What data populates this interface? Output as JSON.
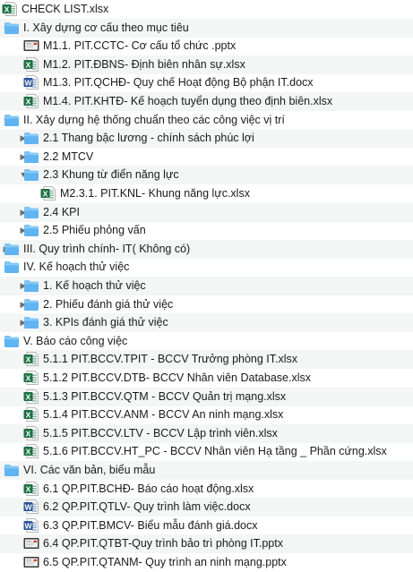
{
  "items": [
    {
      "label": "CHECK LIST.xlsx",
      "type": "xlsx",
      "level": 0,
      "toggle": "none"
    },
    {
      "label": "I. Xây dựng cơ cấu theo mục tiêu",
      "type": "folder",
      "level": 0,
      "toggle": "open"
    },
    {
      "label": "M1.1. PIT.CCTC- Cơ cấu tổ chức .pptx",
      "type": "pptx",
      "level": 1,
      "toggle": "none"
    },
    {
      "label": "M1.2. PIT.ĐBNS- Định biên nhân sự.xlsx",
      "type": "xlsx",
      "level": 1,
      "toggle": "none"
    },
    {
      "label": "M1.3. PIT.QCHĐ- Quy chế Hoạt động Bộ phận IT.docx",
      "type": "docx",
      "level": 1,
      "toggle": "none"
    },
    {
      "label": "M1.4. PIT.KHTĐ- Kế hoạch tuyển dụng theo định biên.xlsx",
      "type": "xlsx",
      "level": 1,
      "toggle": "none"
    },
    {
      "label": "II. Xây dựng hệ thống chuẩn theo các công việc vị trí",
      "type": "folder",
      "level": 0,
      "toggle": "open"
    },
    {
      "label": "2.1 Thang bậc lương - chính sách phúc lợi",
      "type": "folder",
      "level": 1,
      "toggle": "closed"
    },
    {
      "label": "2.2 MTCV",
      "type": "folder",
      "level": 1,
      "toggle": "closed"
    },
    {
      "label": "2.3 Khung từ điển năng lực",
      "type": "folder",
      "level": 1,
      "toggle": "open"
    },
    {
      "label": "M2.3.1. PIT.KNL- Khung năng lực.xlsx",
      "type": "xlsx",
      "level": 2,
      "toggle": "none"
    },
    {
      "label": "2.4 KPI",
      "type": "folder",
      "level": 1,
      "toggle": "closed"
    },
    {
      "label": "2.5 Phiếu phỏng vấn",
      "type": "folder",
      "level": 1,
      "toggle": "closed"
    },
    {
      "label": "III. Quy trình chính- IT( Không có)",
      "type": "folder",
      "level": 0,
      "toggle": "closed"
    },
    {
      "label": "IV. Kế hoạch thử việc",
      "type": "folder",
      "level": 0,
      "toggle": "open"
    },
    {
      "label": "1. Kế hoạch thử việc",
      "type": "folder",
      "level": 1,
      "toggle": "closed"
    },
    {
      "label": "2. Phiếu đánh giá thử việc",
      "type": "folder",
      "level": 1,
      "toggle": "closed"
    },
    {
      "label": "3. KPIs đánh giá thử việc",
      "type": "folder",
      "level": 1,
      "toggle": "closed"
    },
    {
      "label": "V. Báo cáo công việc",
      "type": "folder",
      "level": 0,
      "toggle": "open"
    },
    {
      "label": "5.1.1 PIT.BCCV.TPIT - BCCV Trưởng phòng IT.xlsx",
      "type": "xlsx",
      "level": 1,
      "toggle": "none"
    },
    {
      "label": "5.1.2 PIT.BCCV.DTB- BCCV Nhân viên Database.xlsx",
      "type": "xlsx",
      "level": 1,
      "toggle": "none"
    },
    {
      "label": "5.1.3 PIT.BCCV.QTM - BCCV Quản trị mạng.xlsx",
      "type": "xlsx",
      "level": 1,
      "toggle": "none"
    },
    {
      "label": "5.1.4 PIT.BCCV.ANM - BCCV An ninh mạng.xlsx",
      "type": "xlsx",
      "level": 1,
      "toggle": "none"
    },
    {
      "label": "5.1.5 PIT.BCCV.LTV - BCCV Lập trình viên.xlsx",
      "type": "xlsx",
      "level": 1,
      "toggle": "none"
    },
    {
      "label": "5.1.6 PIT.BCCV.HT_PC - BCCV Nhân viên Hạ tầng _ Phần cứng.xlsx",
      "type": "xlsx",
      "level": 1,
      "toggle": "none"
    },
    {
      "label": "VI. Các văn bản, biểu mẫu",
      "type": "folder",
      "level": 0,
      "toggle": "open"
    },
    {
      "label": "6.1 QP.PIT.BCHĐ- Báo cáo hoạt động.xlsx",
      "type": "xlsx",
      "level": 1,
      "toggle": "none"
    },
    {
      "label": "6.2 QP.PIT.QTLV- Quy trình làm việc.docx",
      "type": "docx",
      "level": 1,
      "toggle": "none"
    },
    {
      "label": "6.3 QP.PIT.BMCV- Biểu mẫu đánh giá.docx",
      "type": "docx",
      "level": 1,
      "toggle": "none"
    },
    {
      "label": "6.4 QP.PIT.QTBT-Quy trình bảo trì phòng IT.pptx",
      "type": "pptx",
      "level": 1,
      "toggle": "none"
    },
    {
      "label": "6.5 QP.PIT.QTANM- Quy trình an ninh mạng.pptx",
      "type": "pptx",
      "level": 1,
      "toggle": "none"
    }
  ],
  "colors": {
    "folder": "#5fb4f1",
    "folder_tab": "#7cc4f5",
    "xlsx": "#1e7145",
    "docx": "#2b579a",
    "pptx": "#444444",
    "row_alt": "#f4f5f5"
  }
}
